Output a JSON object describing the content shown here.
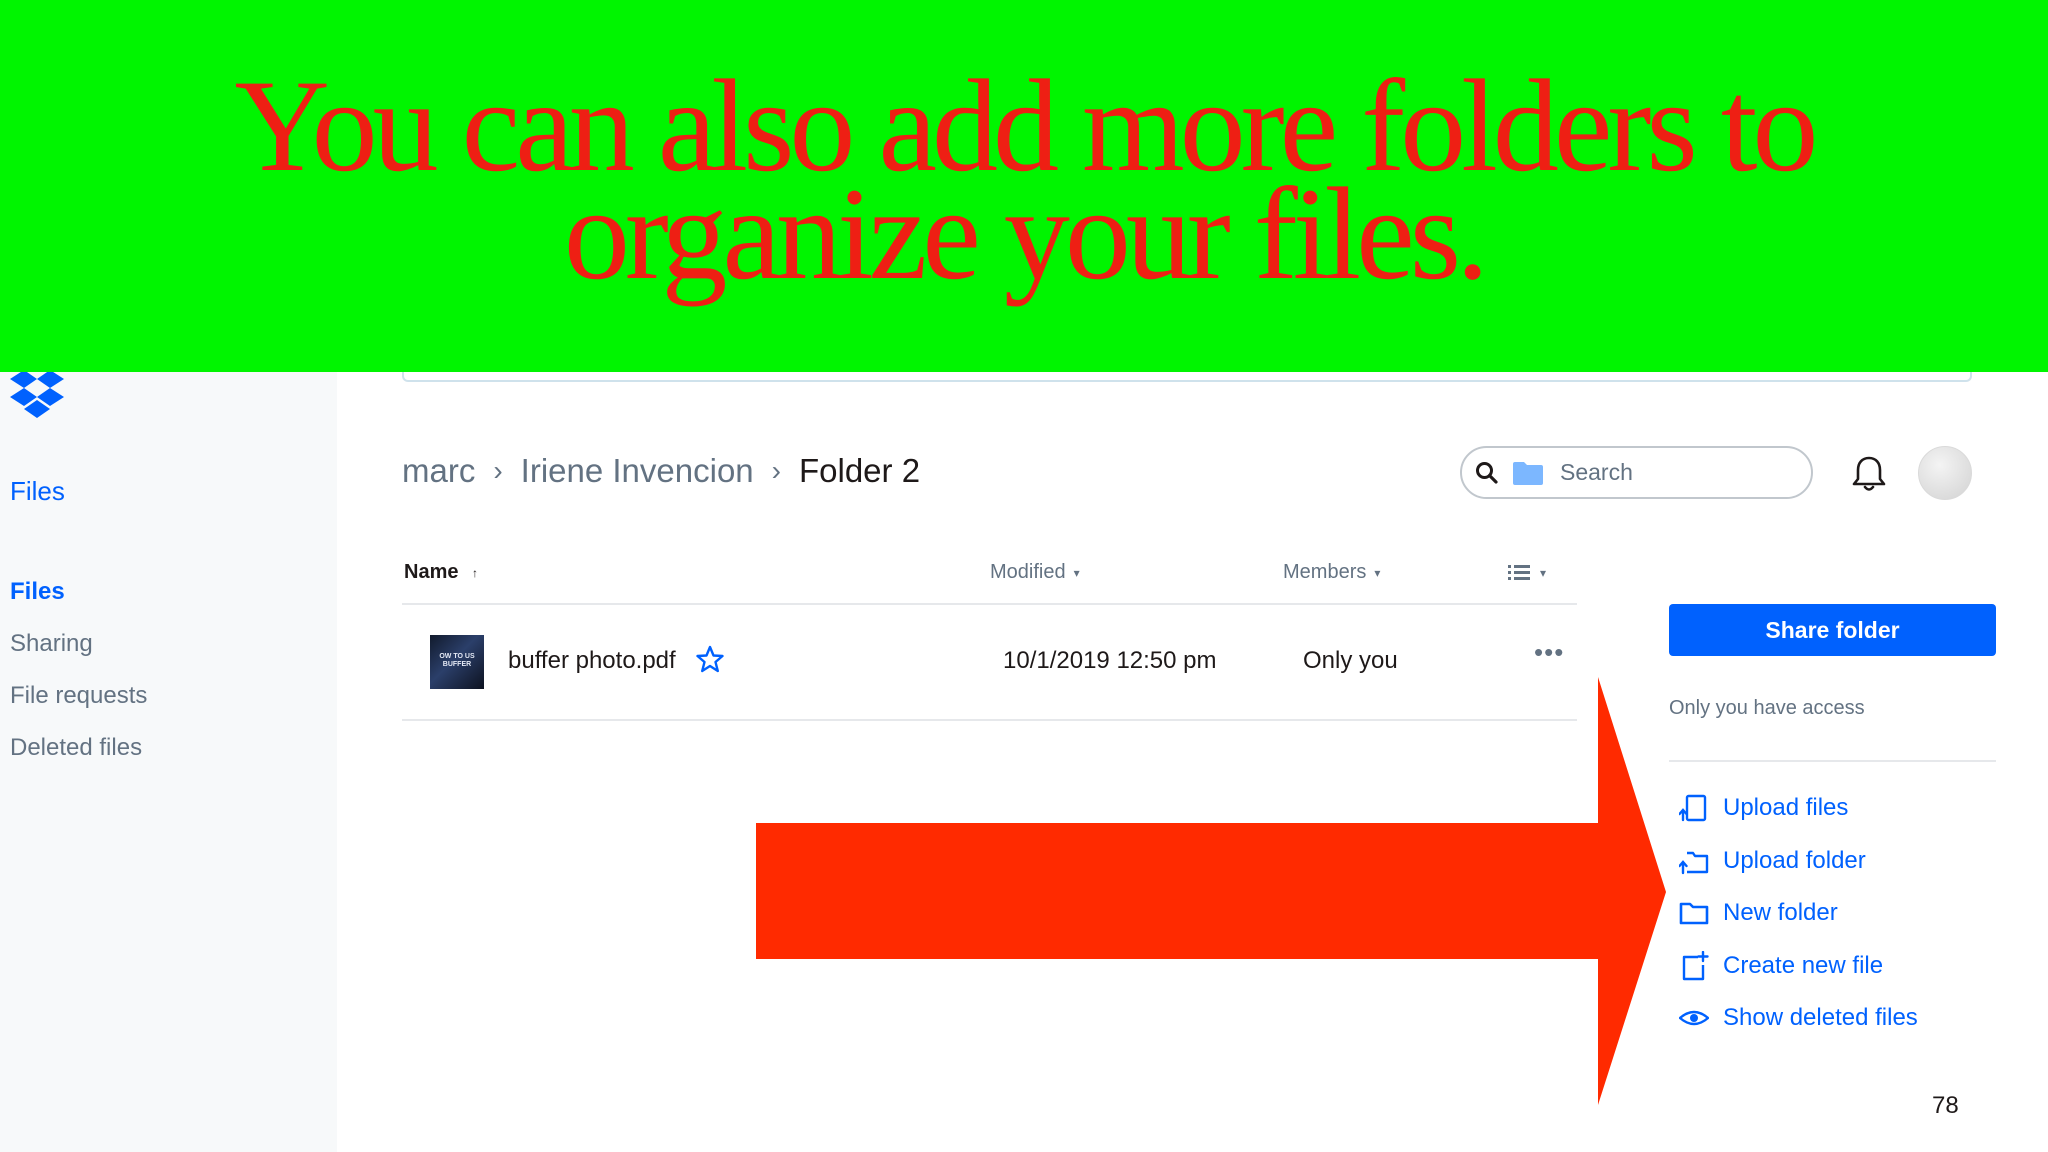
{
  "overlay": {
    "caption_line1": "You can also add more folders to",
    "caption_line2": "organize your files.",
    "banner_color": "#00f500",
    "text_color": "#ee1f14",
    "arrow_color": "#ff2a00"
  },
  "sidebar": {
    "logo_icon": "dropbox-logo-icon",
    "title": "Files",
    "items": [
      {
        "label": "Files",
        "active": true
      },
      {
        "label": "Sharing",
        "active": false
      },
      {
        "label": "File requests",
        "active": false
      },
      {
        "label": "Deleted files",
        "active": false
      }
    ]
  },
  "breadcrumb": {
    "items": [
      "marc",
      "Iriene Invencion"
    ],
    "current": "Folder 2",
    "separator": "›"
  },
  "search": {
    "placeholder": "Search"
  },
  "table": {
    "columns": {
      "name": "Name",
      "name_sort": "↑",
      "modified": "Modified",
      "members": "Members",
      "caret": "▾"
    },
    "rows": [
      {
        "thumb_text": "OW TO US BUFFER",
        "name": "buffer photo.pdf",
        "modified": "10/1/2019 12:50 pm",
        "members": "Only you",
        "more": "•••"
      }
    ]
  },
  "panel": {
    "share_button": "Share folder",
    "access_text": "Only you have access",
    "actions": [
      {
        "label": "Upload files",
        "icon": "upload-files-icon"
      },
      {
        "label": "Upload folder",
        "icon": "upload-folder-icon"
      },
      {
        "label": "New folder",
        "icon": "new-folder-icon"
      },
      {
        "label": "Create new file",
        "icon": "create-file-icon"
      },
      {
        "label": "Show deleted files",
        "icon": "eye-icon"
      }
    ]
  },
  "page_number": "78",
  "colors": {
    "accent": "#0061fe",
    "muted": "#637282",
    "sidebar_bg": "#f7f9fa"
  }
}
